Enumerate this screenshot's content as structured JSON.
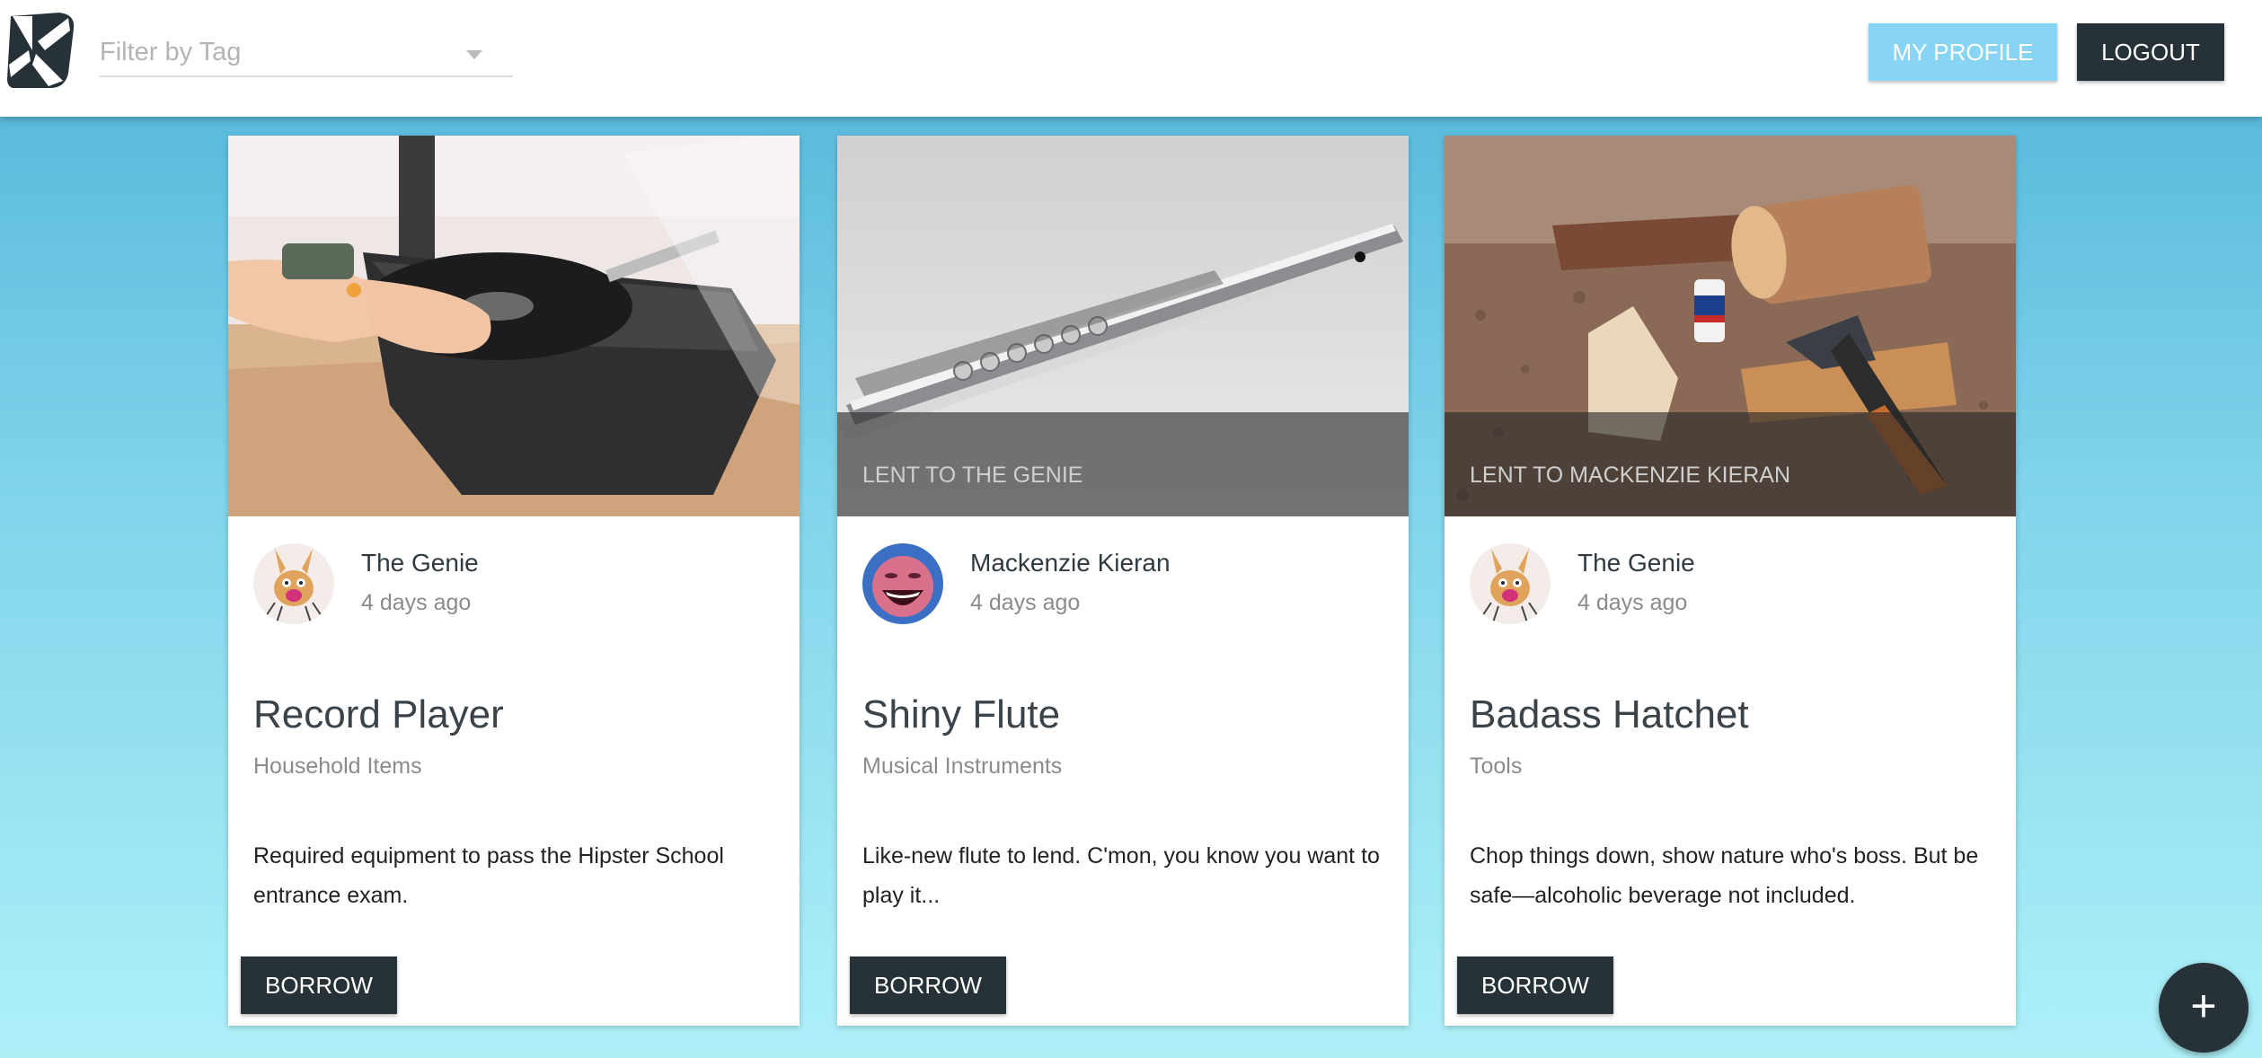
{
  "header": {
    "logo": "k-logo-icon",
    "filter_placeholder": "Filter by Tag",
    "profile_label": "MY PROFILE",
    "logout_label": "LOGOUT"
  },
  "cards": [
    {
      "overlay": "",
      "owner": "The Genie",
      "time": "4 days ago",
      "title": "Record Player",
      "tag": "Household Items",
      "description": "Required equipment to pass the Hipster School entrance exam.",
      "button": "BORROW"
    },
    {
      "overlay": "LENT TO THE GENIE",
      "owner": "Mackenzie Kieran",
      "time": "4 days ago",
      "title": "Shiny Flute",
      "tag": "Musical Instruments",
      "description": "Like-new flute to lend. C'mon, you know you want to play it...",
      "button": "BORROW"
    },
    {
      "overlay": "LENT TO MACKENZIE KIERAN",
      "owner": "The Genie",
      "time": "4 days ago",
      "title": "Badass Hatchet",
      "tag": "Tools",
      "description": "Chop things down, show nature who's boss. But be safe—alcoholic beverage not included.",
      "button": "BORROW"
    }
  ],
  "fab": {
    "label": "+"
  },
  "colors": {
    "accent": "#87d4f5",
    "dark": "#263238"
  }
}
